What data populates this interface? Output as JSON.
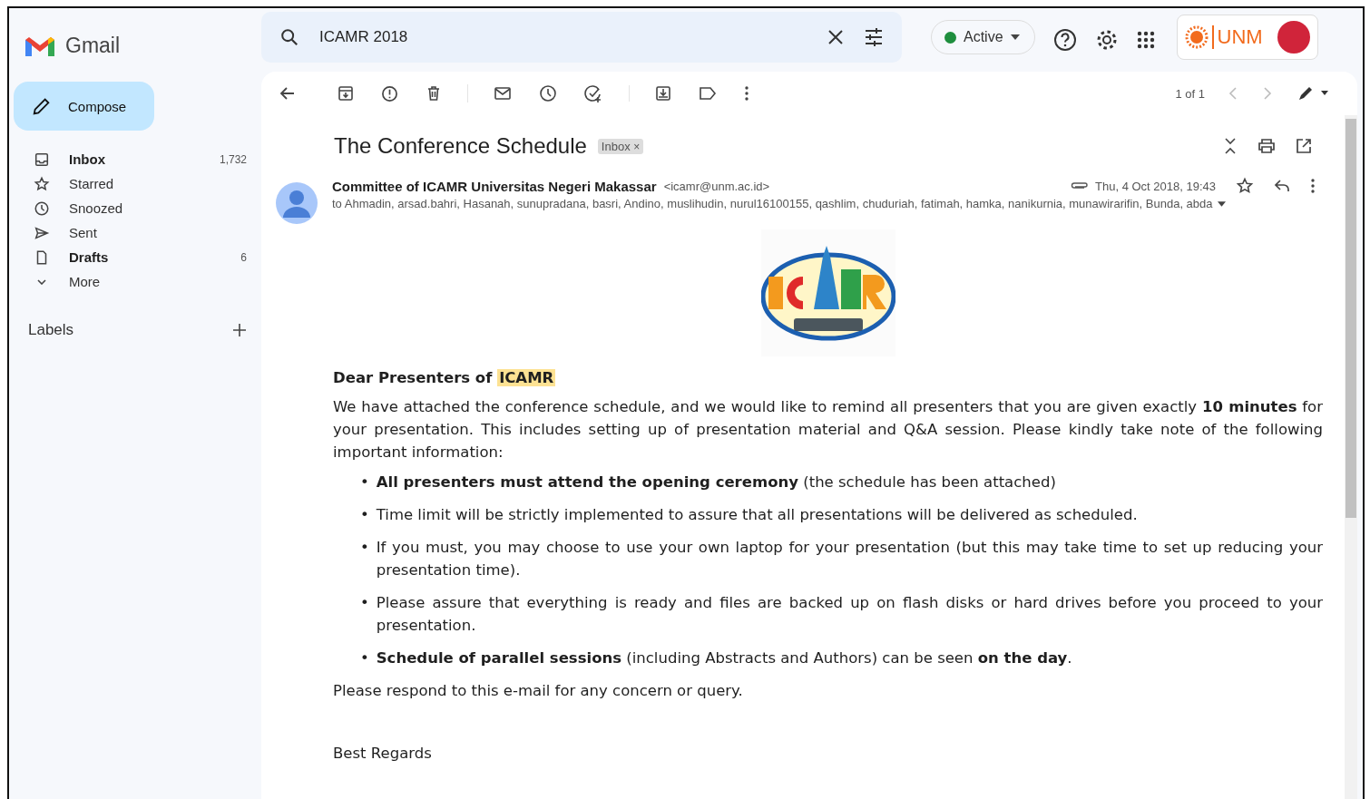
{
  "app": {
    "name": "Gmail"
  },
  "search": {
    "value": "ICAMR 2018"
  },
  "status": {
    "label": "Active"
  },
  "account": {
    "org": "UNM"
  },
  "compose": {
    "label": "Compose"
  },
  "nav": [
    {
      "label": "Inbox",
      "count": "1,732",
      "unread": true
    },
    {
      "label": "Starred",
      "unread": false
    },
    {
      "label": "Snoozed",
      "unread": false
    },
    {
      "label": "Sent",
      "unread": false
    },
    {
      "label": "Drafts",
      "count": "6",
      "unread": true
    },
    {
      "label": "More",
      "unread": false
    }
  ],
  "labels": {
    "title": "Labels"
  },
  "toolbar": {
    "pager": "1 of 1"
  },
  "message": {
    "subject": "The Conference Schedule",
    "tag": "Inbox",
    "tag_close": "×",
    "sender": "Committee of ICAMR Universitas Negeri Makassar",
    "email": "<icamr@unm.ac.id>",
    "date": "Thu, 4 Oct 2018, 19:43",
    "recipients": "to Ahmadin, arsad.bahri, Hasanah, sunupradana, basri, Andino, muslihudin, nurul16100155, qashlim, chuduriah, fatimah, hamka, nanikurnia, munawirarifin, Bunda, abda",
    "greeting": {
      "text": "Dear Presenters of",
      "highlight": "ICAMR"
    },
    "intro": "We have attached the conference schedule, and we would like to remind all presenters that you are given exactly **10 minutes** for your presentation. This includes setting up of presentation material and Q&A session. Please kindly take note of the following important information:",
    "bullets": [
      {
        "marker": "•",
        "text": "**All presenters must attend the opening ceremony** (the schedule has been attached)"
      },
      {
        "marker": "•",
        "text": "Time limit will be strictly implemented to assure that all presentations will be delivered as scheduled."
      },
      {
        "marker": "•",
        "text": "If you must, you may choose to use your own laptop for your presentation (but this may take time to set up reducing your presentation time)."
      },
      {
        "marker": "•",
        "text": "Please assure that everything is ready and files are backed up on flash disks or hard drives before you proceed to your presentation."
      },
      {
        "marker": "•",
        "text": "**Schedule of parallel sessions** (including Abstracts and Authors) can be seen **on the day**."
      }
    ],
    "closing": "Please respond to this e-mail for any concern or query.",
    "signoff": "Best Regards"
  }
}
